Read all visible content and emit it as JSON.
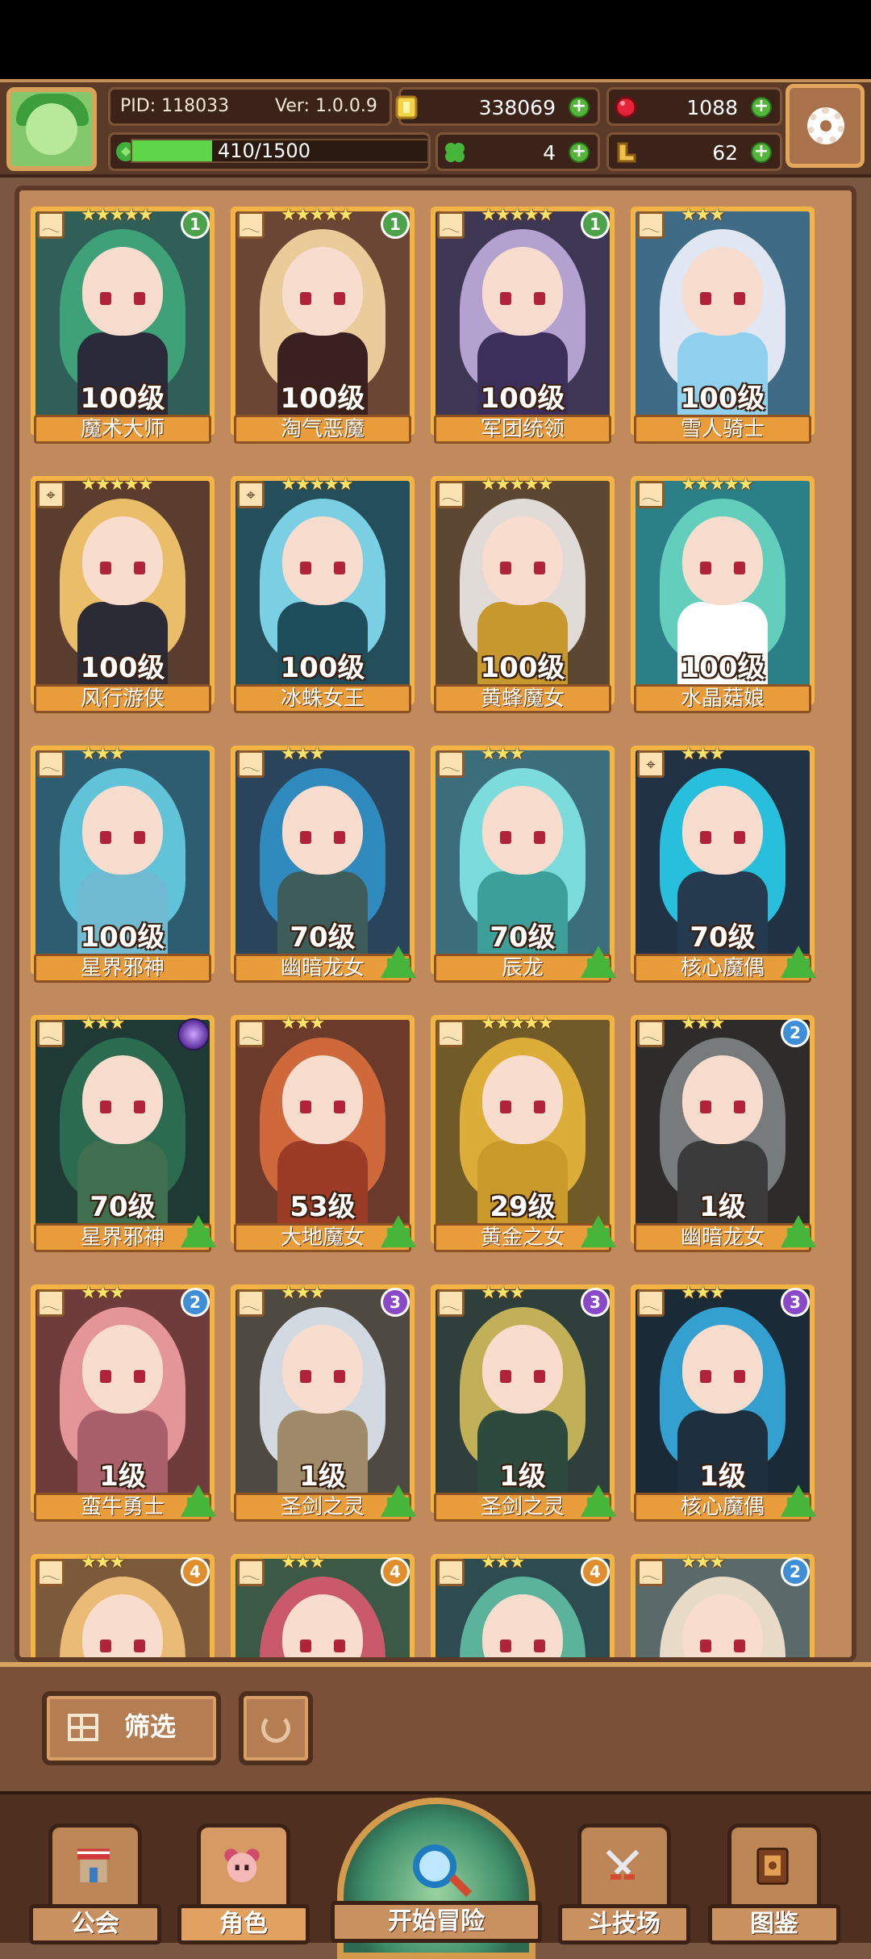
{
  "header": {
    "pid_label": "PID: 118033",
    "version_label": "Ver: 1.0.0.9",
    "gold": "338069",
    "gems": "1088",
    "clover": "4",
    "boots": "62",
    "xp_text": "410/1500",
    "xp_progress": 0.27
  },
  "cards": [
    {
      "name": "魔术大师",
      "level": "100级",
      "stars": "★★★★★",
      "tier": "1",
      "tier_class": "tier-1",
      "hair": "#3fa47a",
      "outfit": "#2a2a3a",
      "bg": "#2f5f57",
      "type_icon": "𓂃",
      "arrow": false
    },
    {
      "name": "淘气恶魔",
      "level": "100级",
      "stars": "★★★★★",
      "tier": "1",
      "tier_class": "tier-1",
      "hair": "#f0d4a0",
      "outfit": "#3a2020",
      "bg": "#6b4634",
      "type_icon": "𓂃",
      "arrow": false
    },
    {
      "name": "军团统领",
      "level": "100级",
      "stars": "★★★★★",
      "tier": "1",
      "tier_class": "tier-1",
      "hair": "#b9a8d6",
      "outfit": "#3d2f5c",
      "bg": "#3e3753",
      "type_icon": "𓂃",
      "arrow": false
    },
    {
      "name": "雪人骑士",
      "level": "100级",
      "stars": "★★★",
      "tier": "",
      "tier_class": "",
      "hair": "#e9eef8",
      "outfit": "#8fd0ef",
      "bg": "#3f6b87",
      "type_icon": "𓂃",
      "arrow": false
    },
    {
      "name": "风行游侠",
      "level": "100级",
      "stars": "★★★★★",
      "tier": "",
      "tier_class": "",
      "hair": "#f2c56b",
      "outfit": "#2b2b35",
      "bg": "#5a3d2e",
      "type_icon": "⌖",
      "arrow": false
    },
    {
      "name": "冰蛛女王",
      "level": "100级",
      "stars": "★★★★★",
      "tier": "",
      "tier_class": "",
      "hair": "#7fd6ea",
      "outfit": "#1e4e5c",
      "bg": "#234e5a",
      "type_icon": "⌖",
      "arrow": false
    },
    {
      "name": "黄蜂魔女",
      "level": "100级",
      "stars": "★★★★★",
      "tier": "",
      "tier_class": "",
      "hair": "#e8e4e0",
      "outfit": "#c7982d",
      "bg": "#5b4732",
      "type_icon": "𓂃",
      "arrow": false
    },
    {
      "name": "水晶菇娘",
      "level": "100级",
      "stars": "★★★★★",
      "tier": "",
      "tier_class": "",
      "hair": "#67d3c0",
      "outfit": "#ffffff",
      "bg": "#2b7f86",
      "type_icon": "𓂃",
      "arrow": false
    },
    {
      "name": "星界邪神",
      "level": "100级",
      "stars": "★★★",
      "tier": "",
      "tier_class": "",
      "hair": "#64c8dd",
      "outfit": "#6fbad1",
      "bg": "#2e5d72",
      "type_icon": "𓂃",
      "arrow": false
    },
    {
      "name": "幽暗龙女",
      "level": "70级",
      "stars": "★★★",
      "tier": "",
      "tier_class": "",
      "hair": "#2f8fc4",
      "outfit": "#3e5d5a",
      "bg": "#29445b",
      "type_icon": "𓂃",
      "arrow": true
    },
    {
      "name": "辰龙",
      "level": "70级",
      "stars": "★★★",
      "tier": "",
      "tier_class": "",
      "hair": "#7fe1e0",
      "outfit": "#3d9f9a",
      "bg": "#3c6d7a",
      "type_icon": "𓂃",
      "arrow": true
    },
    {
      "name": "核心魔偶",
      "level": "70级",
      "stars": "★★★",
      "tier": "",
      "tier_class": "",
      "hair": "#29c7e6",
      "outfit": "#253a4e",
      "bg": "#203243",
      "type_icon": "⌖",
      "arrow": true
    },
    {
      "name": "星界邪神",
      "level": "70级",
      "stars": "★★★",
      "tier": "",
      "tier_class": "",
      "hair": "#2c6e52",
      "outfit": "#3f6f4e",
      "bg": "#1f3a34",
      "type_icon": "𓂃",
      "arrow": true,
      "aura": true
    },
    {
      "name": "大地魔女",
      "level": "53级",
      "stars": "★★★",
      "tier": "",
      "tier_class": "",
      "hair": "#d56a3c",
      "outfit": "#9c3c26",
      "bg": "#6b3a2a",
      "type_icon": "𓂃",
      "arrow": true
    },
    {
      "name": "黄金之女",
      "level": "29级",
      "stars": "★★★★★",
      "tier": "",
      "tier_class": "",
      "hair": "#e2b23a",
      "outfit": "#c99a2a",
      "bg": "#6f5a28",
      "type_icon": "𓂃",
      "arrow": true
    },
    {
      "name": "幽暗龙女",
      "level": "1级",
      "stars": "★★★",
      "tier": "2",
      "tier_class": "tier-2",
      "hair": "#7b7f7f",
      "outfit": "#3b3b3b",
      "bg": "#2e2b2b",
      "type_icon": "𓂃",
      "arrow": true
    },
    {
      "name": "蛮牛勇士",
      "level": "1级",
      "stars": "★★★",
      "tier": "2",
      "tier_class": "tier-2",
      "hair": "#e99a9c",
      "outfit": "#a9606a",
      "bg": "#6e3c3a",
      "type_icon": "𓂃",
      "arrow": true
    },
    {
      "name": "圣剑之灵",
      "level": "1级",
      "stars": "★★★",
      "tier": "3",
      "tier_class": "tier-3",
      "hair": "#d9e0ea",
      "outfit": "#9f8b6a",
      "bg": "#4e4a42",
      "type_icon": "𓂃",
      "arrow": true
    },
    {
      "name": "圣剑之灵",
      "level": "1级",
      "stars": "★★★",
      "tier": "3",
      "tier_class": "tier-3",
      "hair": "#c9b65a",
      "outfit": "#2c4a3e",
      "bg": "#2f3f3c",
      "type_icon": "𓂃",
      "arrow": true
    },
    {
      "name": "核心魔偶",
      "level": "1级",
      "stars": "★★★",
      "tier": "3",
      "tier_class": "tier-3",
      "hair": "#35a6d9",
      "outfit": "#1e2f3e",
      "bg": "#1a2a36",
      "type_icon": "𓂃",
      "arrow": true
    },
    {
      "name": "",
      "level": "",
      "stars": "★★★",
      "tier": "4",
      "tier_class": "tier-4",
      "hair": "#f0c07a",
      "outfit": "#c08a5d",
      "bg": "#7a5a3a",
      "type_icon": "𓂃",
      "arrow": false
    },
    {
      "name": "",
      "level": "",
      "stars": "★★★",
      "tier": "4",
      "tier_class": "tier-4",
      "hair": "#d25a6e",
      "outfit": "#5fae6e",
      "bg": "#3a5a46",
      "type_icon": "𓂃",
      "arrow": false
    },
    {
      "name": "",
      "level": "",
      "stars": "★★★",
      "tier": "4",
      "tier_class": "tier-4",
      "hair": "#5fb8a0",
      "outfit": "#3a7a6a",
      "bg": "#2e4c50",
      "type_icon": "𓂃",
      "arrow": false
    },
    {
      "name": "",
      "level": "",
      "stars": "★★★",
      "tier": "2",
      "tier_class": "tier-2",
      "hair": "#efe2cc",
      "outfit": "#b9c8b4",
      "bg": "#5a6a6a",
      "type_icon": "𓂃",
      "arrow": false
    }
  ],
  "controls": {
    "filter_label": "筛选",
    "reset_icon": "refresh-icon"
  },
  "nav": {
    "guild": "公会",
    "characters": "角色",
    "adventure": "开始冒险",
    "arena": "斗技场",
    "codex": "图鉴"
  },
  "colors": {
    "accent_gold": "#f4b443",
    "progress_green": "#5fd64a"
  }
}
